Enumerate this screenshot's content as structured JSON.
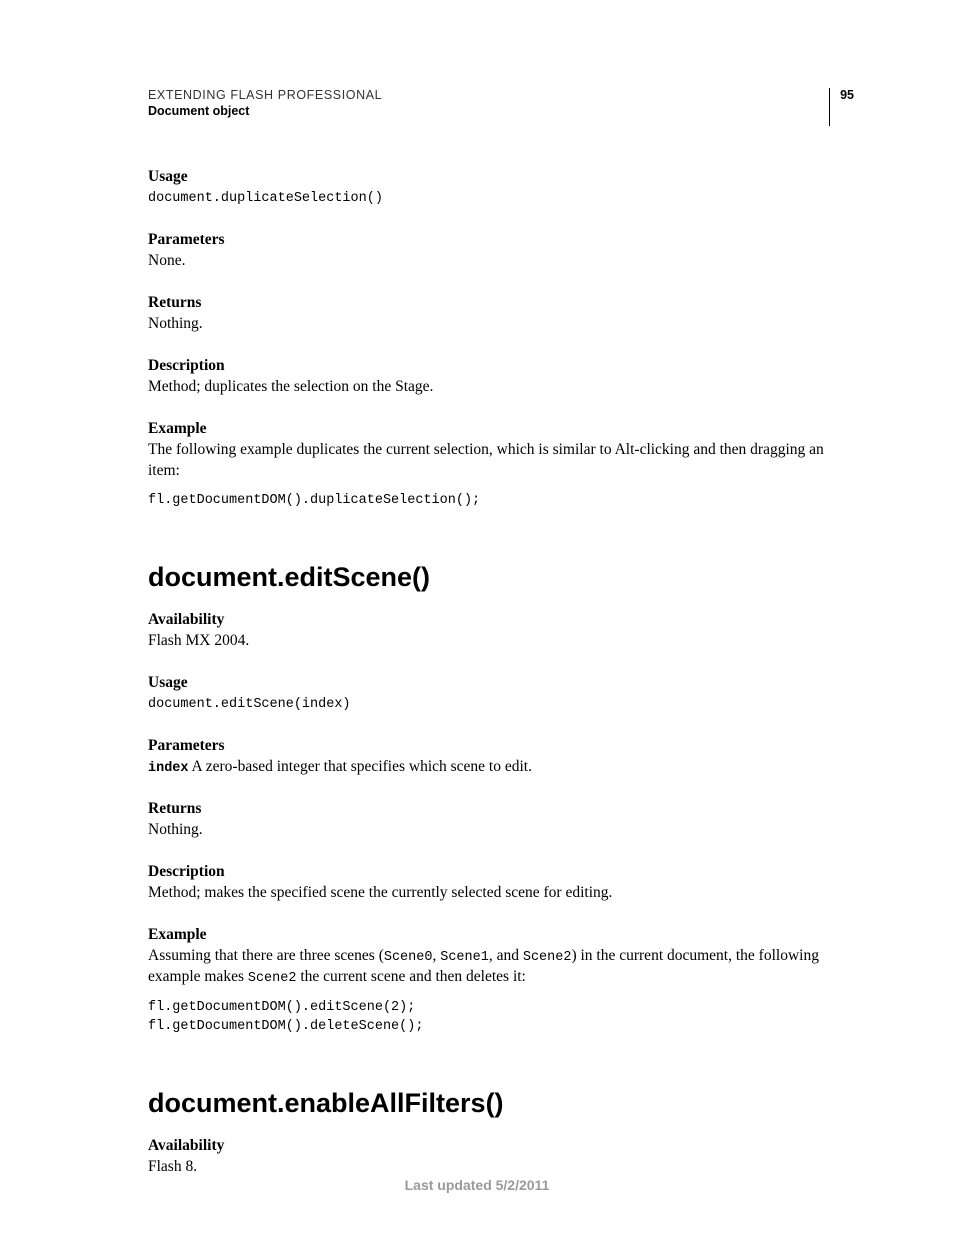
{
  "header": {
    "title": "EXTENDING FLASH PROFESSIONAL",
    "section": "Document object",
    "page_number": "95"
  },
  "sec1": {
    "usage_label": "Usage",
    "usage_code": "document.duplicateSelection()",
    "parameters_label": "Parameters",
    "parameters_body": "None.",
    "returns_label": "Returns",
    "returns_body": "Nothing.",
    "description_label": "Description",
    "description_body": "Method; duplicates the selection on the Stage.",
    "example_label": "Example",
    "example_body": "The following example duplicates the current selection, which is similar to Alt-clicking and then dragging an item:",
    "example_code": "fl.getDocumentDOM().duplicateSelection();"
  },
  "sec2": {
    "heading": "document.editScene()",
    "availability_label": "Availability",
    "availability_body": "Flash MX 2004.",
    "usage_label": "Usage",
    "usage_code": "document.editScene(index)",
    "parameters_label": "Parameters",
    "param_name": "index",
    "param_body": "  A zero-based integer that specifies which scene to edit.",
    "returns_label": "Returns",
    "returns_body": "Nothing.",
    "description_label": "Description",
    "description_body": "Method; makes the specified scene the currently selected scene for editing.",
    "example_label": "Example",
    "ex_pre": "Assuming that there are three scenes (",
    "ex_s0": "Scene0",
    "ex_c1": ", ",
    "ex_s1": "Scene1",
    "ex_c2": ", and ",
    "ex_s2": "Scene2",
    "ex_mid": ") in the current document, the following example makes ",
    "ex_s2b": "Scene2",
    "ex_post": " the current scene and then deletes it:",
    "example_code": "fl.getDocumentDOM().editScene(2);\nfl.getDocumentDOM().deleteScene();"
  },
  "sec3": {
    "heading": "document.enableAllFilters()",
    "availability_label": "Availability",
    "availability_body": "Flash 8."
  },
  "footer": {
    "text": "Last updated 5/2/2011"
  }
}
